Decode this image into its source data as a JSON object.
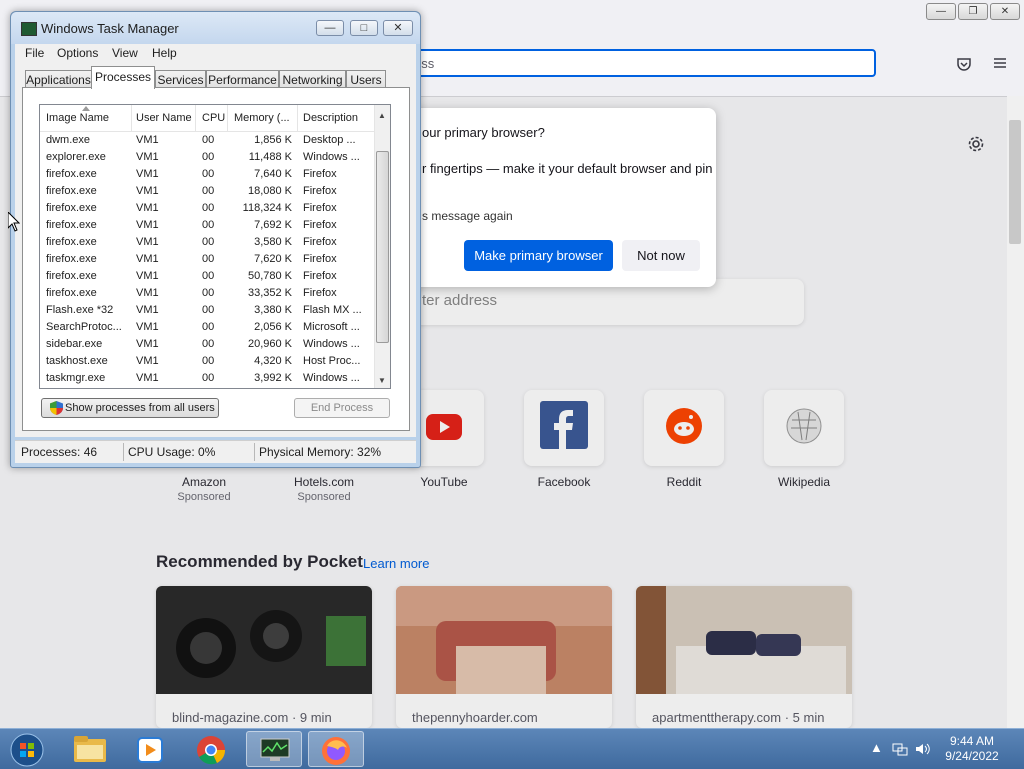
{
  "firefox": {
    "url_text": "ess",
    "dialog": {
      "title": "our primary browser?",
      "body": "r fingertips — make it your default browser and pin",
      "checkbox_label": "s message again",
      "primary_button": "Make primary browser",
      "secondary_button": "Not now"
    },
    "search_placeholder": "ter address",
    "top_sites": [
      {
        "label": "Amazon",
        "sponsored": "Sponsored"
      },
      {
        "label": "Hotels.com",
        "sponsored": "Sponsored"
      },
      {
        "label": "YouTube",
        "sponsored": ""
      },
      {
        "label": "Facebook",
        "sponsored": ""
      },
      {
        "label": "Reddit",
        "sponsored": ""
      },
      {
        "label": "Wikipedia",
        "sponsored": ""
      }
    ],
    "pocket": {
      "title": "Recommended by Pocket",
      "learn_more": "Learn more",
      "cards": [
        {
          "source": "blind-magazine.com · 9 min"
        },
        {
          "source": "thepennyhoarder.com"
        },
        {
          "source": "apartmenttherapy.com · 5 min"
        }
      ]
    }
  },
  "taskmgr": {
    "title": "Windows Task Manager",
    "menu": [
      "File",
      "Options",
      "View",
      "Help"
    ],
    "tabs": [
      "Applications",
      "Processes",
      "Services",
      "Performance",
      "Networking",
      "Users"
    ],
    "active_tab": "Processes",
    "columns": [
      "Image Name",
      "User Name",
      "CPU",
      "Memory (...",
      "Description"
    ],
    "rows": [
      {
        "name": "dwm.exe",
        "user": "VM1",
        "cpu": "00",
        "mem": "1,856 K",
        "desc": "Desktop ..."
      },
      {
        "name": "explorer.exe",
        "user": "VM1",
        "cpu": "00",
        "mem": "11,488 K",
        "desc": "Windows ..."
      },
      {
        "name": "firefox.exe",
        "user": "VM1",
        "cpu": "00",
        "mem": "7,640 K",
        "desc": "Firefox"
      },
      {
        "name": "firefox.exe",
        "user": "VM1",
        "cpu": "00",
        "mem": "18,080 K",
        "desc": "Firefox"
      },
      {
        "name": "firefox.exe",
        "user": "VM1",
        "cpu": "00",
        "mem": "118,324 K",
        "desc": "Firefox"
      },
      {
        "name": "firefox.exe",
        "user": "VM1",
        "cpu": "00",
        "mem": "7,692 K",
        "desc": "Firefox"
      },
      {
        "name": "firefox.exe",
        "user": "VM1",
        "cpu": "00",
        "mem": "3,580 K",
        "desc": "Firefox"
      },
      {
        "name": "firefox.exe",
        "user": "VM1",
        "cpu": "00",
        "mem": "7,620 K",
        "desc": "Firefox"
      },
      {
        "name": "firefox.exe",
        "user": "VM1",
        "cpu": "00",
        "mem": "50,780 K",
        "desc": "Firefox"
      },
      {
        "name": "firefox.exe",
        "user": "VM1",
        "cpu": "00",
        "mem": "33,352 K",
        "desc": "Firefox"
      },
      {
        "name": "Flash.exe *32",
        "user": "VM1",
        "cpu": "00",
        "mem": "3,380 K",
        "desc": "Flash MX ..."
      },
      {
        "name": "SearchProtoc...",
        "user": "VM1",
        "cpu": "00",
        "mem": "2,056 K",
        "desc": "Microsoft ..."
      },
      {
        "name": "sidebar.exe",
        "user": "VM1",
        "cpu": "00",
        "mem": "20,960 K",
        "desc": "Windows ..."
      },
      {
        "name": "taskhost.exe",
        "user": "VM1",
        "cpu": "00",
        "mem": "4,320 K",
        "desc": "Host Proc..."
      },
      {
        "name": "taskmgr.exe",
        "user": "VM1",
        "cpu": "00",
        "mem": "3,992 K",
        "desc": "Windows ..."
      }
    ],
    "show_all_button": "Show processes from all users",
    "end_process_button": "End Process",
    "status": {
      "processes": "Processes: 46",
      "cpu": "CPU Usage: 0%",
      "memory": "Physical Memory: 32%"
    }
  },
  "taskbar": {
    "time": "9:44 AM",
    "date": "9/24/2022",
    "apps": [
      "start-orb-icon",
      "explorer-icon",
      "media-player-icon",
      "chrome-icon",
      "task-manager-icon",
      "firefox-icon"
    ]
  },
  "colors": {
    "firefox_accent": "#0061e0",
    "taskbar": "#4a76aa",
    "window_frame": "#b9d1ea"
  }
}
